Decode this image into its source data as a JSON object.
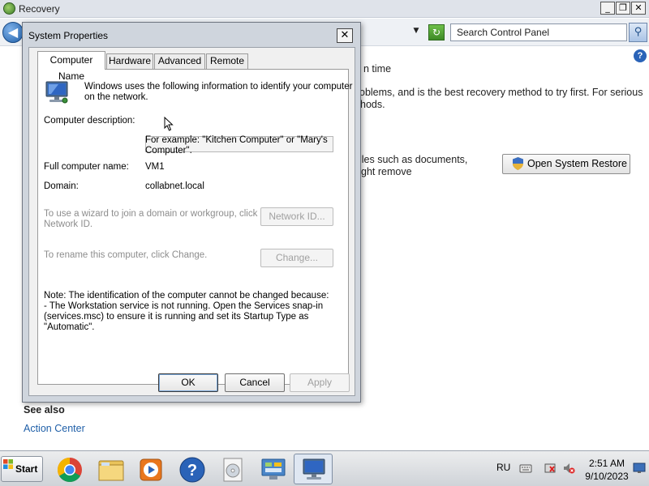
{
  "recovery_window": {
    "title": "Recovery",
    "search_placeholder": "Search Control Panel",
    "text_lines": [
      "n time",
      "oblems, and is the best recovery method to try first. For serious",
      "hods.",
      "iles such as documents,",
      "ght remove"
    ],
    "open_system_restore_label": "Open System Restore",
    "see_also_label": "See also",
    "action_center_link": "Action Center",
    "controls": {
      "minimize": "_",
      "restore": "❐",
      "close": "✕",
      "back": "◀",
      "dropdown": "▼",
      "refresh": "↻",
      "search_icon": "⚲",
      "help": "?"
    }
  },
  "dialog": {
    "title": "System Properties",
    "close_glyph": "✕",
    "tabs": [
      {
        "label": "Computer Name",
        "active": true
      },
      {
        "label": "Hardware",
        "active": false
      },
      {
        "label": "Advanced",
        "active": false
      },
      {
        "label": "Remote",
        "active": false
      }
    ],
    "intro_line1": "Windows uses the following information to identify your computer",
    "intro_line2": "on the network.",
    "description_label": "Computer description:",
    "description_value": "",
    "example_line1": "For example: \"Kitchen Computer\" or \"Mary's",
    "example_line2": "Computer\".",
    "full_name_label": "Full computer name:",
    "full_name_value": "VM1",
    "domain_label": "Domain:",
    "domain_value": "collabnet.local",
    "join_line1": "To use a wizard to join a domain or workgroup, click",
    "join_line2": "Network ID.",
    "network_id_button": "Network ID...",
    "rename_text": "To rename this computer, click Change.",
    "change_button": "Change...",
    "note_lines": [
      "Note: The identification of the computer cannot be changed because:",
      "- The Workstation service is not running. Open the Services snap-in",
      "(services.msc) to ensure it is running and set its Startup Type as",
      "\"Automatic\"."
    ],
    "ok_button": "OK",
    "cancel_button": "Cancel",
    "apply_button": "Apply"
  },
  "taskbar": {
    "start_label": "Start",
    "items": [
      "chrome-icon",
      "file-explorer-icon",
      "media-player-icon",
      "help-support-icon",
      "disc-icon",
      "control-panel-icon",
      "system-properties-icon"
    ],
    "language": "RU",
    "time": "2:51 AM",
    "date": "9/10/2023"
  }
}
